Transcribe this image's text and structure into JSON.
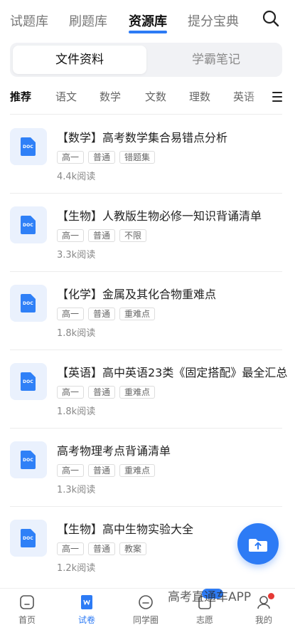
{
  "top_tabs": [
    "试题库",
    "刷题库",
    "资源库",
    "提分宝典"
  ],
  "active_top_tab": "资源库",
  "search_icon": "search-icon",
  "segment": {
    "active": "文件资料",
    "inactive": "学霸笔记"
  },
  "categories": [
    "推荐",
    "语文",
    "数学",
    "文数",
    "理数",
    "英语"
  ],
  "menu_icon": "hamburger-menu-icon",
  "doc_badge": "DOC",
  "docs": [
    {
      "title": "【数学】高考数学集合易错点分析",
      "tags": [
        "高一",
        "普通",
        "错题集"
      ],
      "reads": "4.4k阅读"
    },
    {
      "title": "【生物】人教版生物必修一知识背诵清单",
      "tags": [
        "高一",
        "普通",
        "不限"
      ],
      "reads": "3.3k阅读"
    },
    {
      "title": "【化学】金属及其化合物重难点",
      "tags": [
        "高一",
        "普通",
        "重难点"
      ],
      "reads": "1.8k阅读"
    },
    {
      "title": "【英语】高中英语23类《固定搭配》最全汇总",
      "tags": [
        "高一",
        "普通",
        "重难点"
      ],
      "reads": "1.8k阅读"
    },
    {
      "title": "高考物理考点背诵清单",
      "tags": [
        "高一",
        "普通",
        "重难点"
      ],
      "reads": "1.3k阅读"
    },
    {
      "title": "【生物】高中生物实验大全",
      "tags": [
        "高一",
        "普通",
        "教案"
      ],
      "reads": "1.2k阅读"
    }
  ],
  "fab_icon": "upload-folder-icon",
  "bottom_nav": [
    {
      "label": "首页",
      "icon": "home-icon"
    },
    {
      "label": "试卷",
      "icon": "paper-icon",
      "active": true
    },
    {
      "label": "同学圈",
      "icon": "circle-icon"
    },
    {
      "label": "志愿",
      "icon": "volunteer-icon",
      "badge": ""
    },
    {
      "label": "我的",
      "icon": "profile-icon",
      "dot": true
    }
  ],
  "watermark": "高考直通车APP",
  "colors": {
    "accent": "#2d7bf5",
    "icon_bg": "#eaf1fd",
    "red_dot": "#e53935"
  }
}
